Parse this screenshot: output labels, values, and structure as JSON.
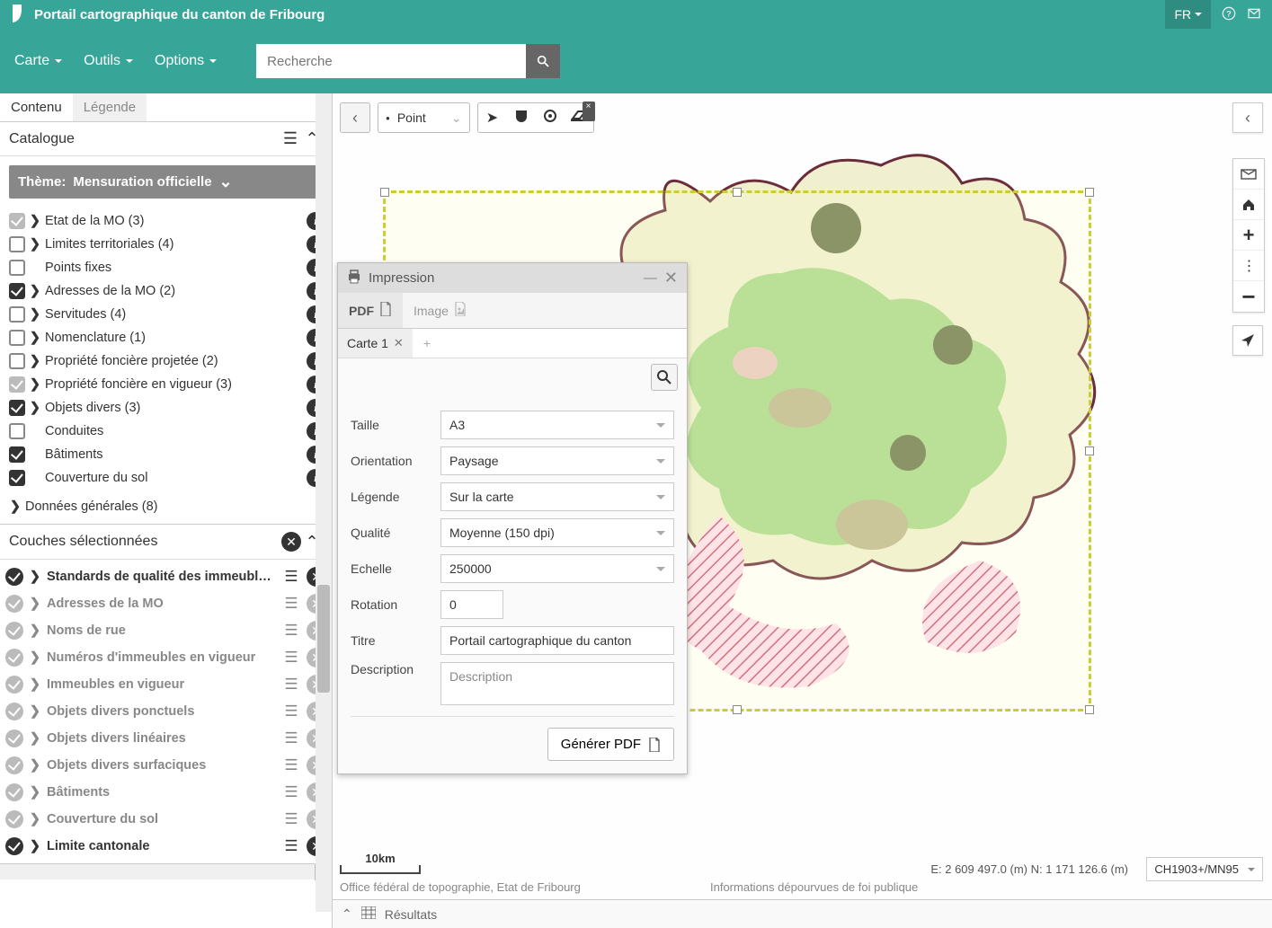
{
  "header": {
    "title": "Portail cartographique du canton de Fribourg",
    "lang": "FR"
  },
  "menu": {
    "carte": "Carte",
    "outils": "Outils",
    "options": "Options",
    "search_placeholder": "Recherche"
  },
  "sidebar": {
    "tab_content": "Contenu",
    "tab_legend": "Légende",
    "catalogue": "Catalogue",
    "theme_prefix": "Thème:",
    "theme_name": "Mensuration officielle",
    "tree": [
      {
        "label": "Etat de la MO (3)",
        "cb": "gry",
        "expand": true,
        "info": true
      },
      {
        "label": "Limites territoriales (4)",
        "cb": "off",
        "expand": true,
        "info": true
      },
      {
        "label": "Points fixes",
        "cb": "off",
        "expand": false,
        "info": true
      },
      {
        "label": "Adresses de la MO (2)",
        "cb": "chk",
        "expand": true,
        "info": true
      },
      {
        "label": "Servitudes (4)",
        "cb": "off",
        "expand": true,
        "info": true
      },
      {
        "label": "Nomenclature (1)",
        "cb": "off",
        "expand": true,
        "info": true
      },
      {
        "label": "Propriété foncière projetée (2)",
        "cb": "off",
        "expand": true,
        "info": true
      },
      {
        "label": "Propriété foncière en vigueur (3)",
        "cb": "gry",
        "expand": true,
        "info": true
      },
      {
        "label": "Objets divers (3)",
        "cb": "chk",
        "expand": true,
        "info": true
      },
      {
        "label": "Conduites",
        "cb": "off",
        "expand": false,
        "info": true
      },
      {
        "label": "Bâtiments",
        "cb": "chk",
        "expand": false,
        "info": true
      },
      {
        "label": "Couverture du sol",
        "cb": "chk",
        "expand": false,
        "info": true
      }
    ],
    "general": "Données générales (8)",
    "selected_title": "Couches sélectionnées",
    "selected": [
      {
        "label": "Standards de qualité des immeubles en v",
        "on": true
      },
      {
        "label": "Adresses de la MO",
        "on": false
      },
      {
        "label": "Noms de rue",
        "on": false
      },
      {
        "label": "Numéros d'immeubles en vigueur",
        "on": false
      },
      {
        "label": "Immeubles en vigueur",
        "on": false
      },
      {
        "label": "Objets divers ponctuels",
        "on": false
      },
      {
        "label": "Objets divers linéaires",
        "on": false
      },
      {
        "label": "Objets divers surfaciques",
        "on": false
      },
      {
        "label": "Bâtiments",
        "on": false
      },
      {
        "label": "Couverture du sol",
        "on": false
      },
      {
        "label": "Limite cantonale",
        "on": true
      }
    ]
  },
  "tools": {
    "geom_label": "Point"
  },
  "print": {
    "title": "Impression",
    "tab_pdf": "PDF",
    "tab_image": "Image",
    "map_tab": "Carte 1",
    "fields": {
      "taille": {
        "label": "Taille",
        "value": "A3"
      },
      "orientation": {
        "label": "Orientation",
        "value": "Paysage"
      },
      "legende": {
        "label": "Légende",
        "value": "Sur la carte"
      },
      "qualite": {
        "label": "Qualité",
        "value": "Moyenne (150 dpi)"
      },
      "echelle": {
        "label": "Echelle",
        "value": "250000"
      },
      "rotation": {
        "label": "Rotation",
        "value": "0"
      },
      "titre": {
        "label": "Titre",
        "value": "Portail cartographique du canton"
      },
      "description": {
        "label": "Description",
        "value": "Description"
      }
    },
    "generate": "Générer PDF"
  },
  "status": {
    "scale": "10km",
    "attribution": "Office fédéral de topographie, Etat de Fribourg",
    "disclaimer": "Informations dépourvues de foi publique",
    "coords": "E: 2 609 497.0 (m)  N: 1 171 126.6 (m)",
    "srs": "CH1903+/MN95",
    "results": "Résultats"
  }
}
